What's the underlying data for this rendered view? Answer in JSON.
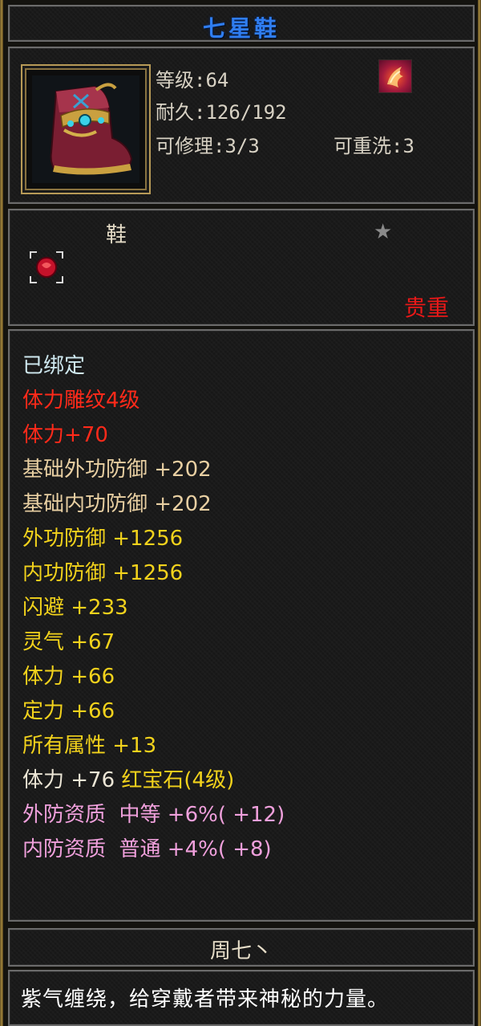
{
  "title": "七星鞋",
  "info": {
    "level": "等级:64",
    "durability": "耐久:126/192",
    "repairable": "可修理:3/3",
    "rewash": "可重洗:3"
  },
  "category": {
    "type": "鞋",
    "rarity": "贵重"
  },
  "attributes": [
    {
      "text": "已绑定",
      "color": "cyan"
    },
    {
      "text": "体力雕纹4级",
      "color": "red"
    },
    {
      "text": "体力+70",
      "color": "red"
    },
    {
      "text": "基础外功防御 +202",
      "color": "tan"
    },
    {
      "text": "基础内功防御 +202",
      "color": "tan"
    },
    {
      "text": "外功防御 +1256",
      "color": "yellow"
    },
    {
      "text": "内功防御 +1256",
      "color": "yellow"
    },
    {
      "text": "闪避 +233",
      "color": "yellow"
    },
    {
      "text": "灵气 +67",
      "color": "yellow"
    },
    {
      "text": "体力 +66",
      "color": "yellow"
    },
    {
      "text": "定力 +66",
      "color": "yellow"
    },
    {
      "text": "所有属性 +13",
      "color": "yellow"
    }
  ],
  "gem_line": {
    "stat": "体力 +76",
    "gem": "红宝石(4级)"
  },
  "aptitudes": [
    "外防资质  中等 +6%( +12)",
    "内防资质  普通 +4%( +8)"
  ],
  "owner": "周七丶",
  "description": "紫气缠绕，给穿戴者带来神秘的力量。",
  "icons": {
    "item": "boot-icon",
    "skill": "fire-bird-icon",
    "favorite": "star-icon",
    "gem_slot": "ruby-slot-icon"
  }
}
